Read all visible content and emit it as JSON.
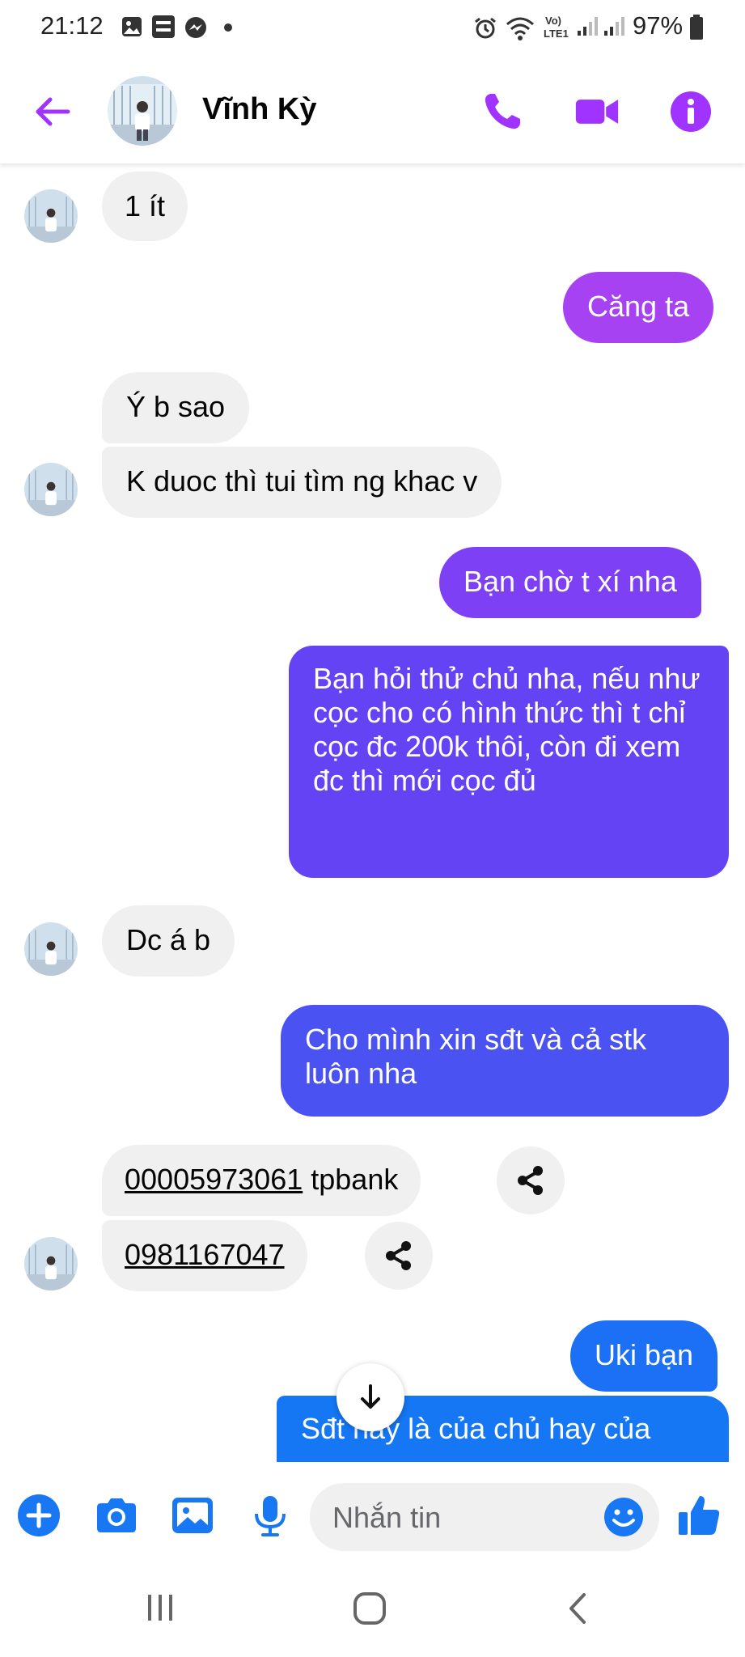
{
  "status": {
    "time": "21:12",
    "battery": "97%",
    "network_label": "Vo) LTE1"
  },
  "header": {
    "back_icon": "arrow-left-icon",
    "contact_name": "Vĩnh Kỳ",
    "call_icon": "phone-icon",
    "video_icon": "video-camera-icon",
    "info_icon": "info-icon",
    "accent": "#a033ff"
  },
  "messages": [
    {
      "side": "in",
      "text": "1 ít"
    },
    {
      "side": "out",
      "text": "Căng ta",
      "color": "#a742f2"
    },
    {
      "side": "in",
      "text": "Ý b sao"
    },
    {
      "side": "in",
      "text": "K duoc thì tui tìm ng khac v"
    },
    {
      "side": "out",
      "text": "Bạn chờ t xí nha",
      "color": "#7e40f4"
    },
    {
      "side": "out",
      "text": "Bạn hỏi thử chủ nha, nếu như cọc cho có hình thức thì t chỉ cọc đc 200k thôi, còn đi xem đc thì mới cọc đủ",
      "color": "#6443f4"
    },
    {
      "side": "in",
      "text": "Dc á b"
    },
    {
      "side": "out",
      "text": "Cho mình xin sđt và cả stk luôn nha",
      "color": "#4b52f2"
    },
    {
      "side": "in",
      "link": "00005973061",
      "text": " tpbank"
    },
    {
      "side": "in",
      "link": "0981167047",
      "text": ""
    },
    {
      "side": "out",
      "text": "Uki bạn",
      "color": "#1c70f5"
    },
    {
      "side": "out",
      "text": "Sđt hay là của chủ hay của",
      "color": "#1577f4"
    }
  ],
  "composer": {
    "placeholder": "Nhắn tin",
    "icons": [
      "plus-circle-icon",
      "camera-icon",
      "image-icon",
      "microphone-icon",
      "emoji-icon",
      "thumbs-up-icon"
    ],
    "accent": "#1877f2"
  },
  "navbar": {
    "icons": [
      "recent-apps-icon",
      "home-icon",
      "back-icon"
    ]
  }
}
